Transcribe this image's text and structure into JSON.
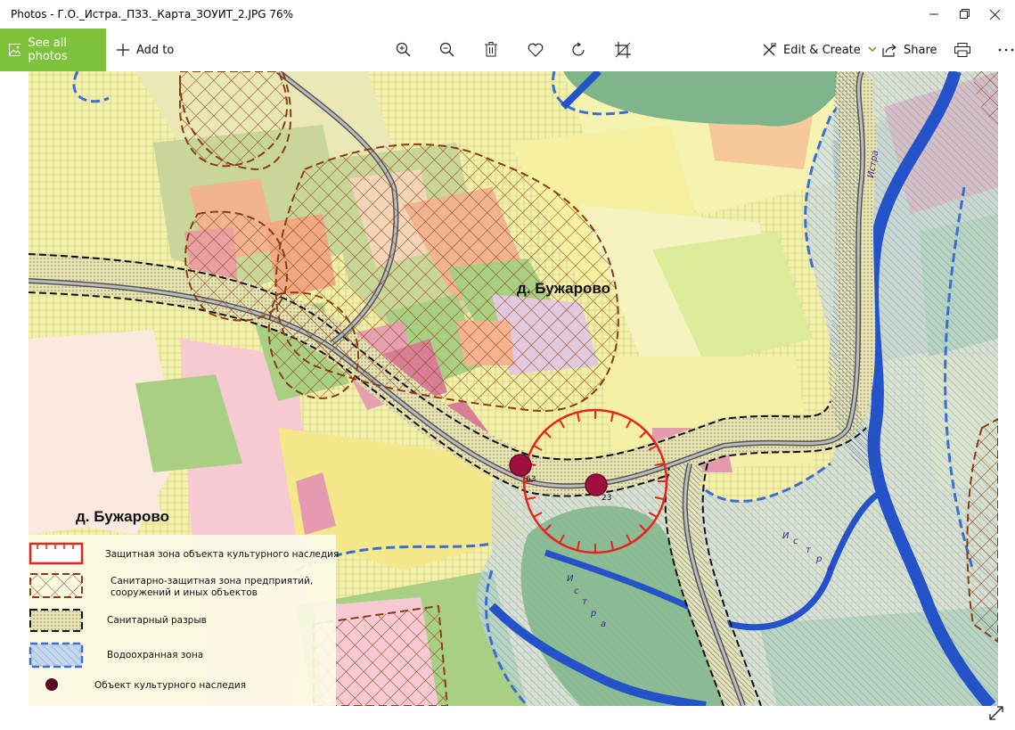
{
  "window": {
    "title": "Photos - Г.О._Истра._ПЗЗ._Карта_ЗОУИТ_2.JPG   76%",
    "minimize_icon": "minimize-icon",
    "maximize_icon": "restore-icon",
    "close_icon": "close-icon"
  },
  "toolbar": {
    "see_all_label": "See all photos",
    "add_to_label": "Add to",
    "edit_create_label": "Edit & Create",
    "share_label": "Share",
    "icons": [
      "zoom-in-icon",
      "zoom-out-icon",
      "delete-icon",
      "favorite-icon",
      "rotate-icon",
      "crop-icon",
      "print-icon",
      "more-icon"
    ],
    "accent": "#7ec23b"
  },
  "map": {
    "place_label_main": "д. Бужарово",
    "place_label_secondary": "д. Бужарово",
    "river_label": "Истра",
    "river_label_letters": [
      "И",
      "с",
      "т",
      "р",
      "а"
    ],
    "monument_numbers": [
      "63",
      "23"
    ],
    "legend": [
      {
        "label": "Защитная зона объекта культурного наследия",
        "color": "#e8221c"
      },
      {
        "label_line1": "Санитарно-защитная зона предприятий,",
        "label_line2": "сооружений и иных объектов",
        "color": "#9a3a12"
      },
      {
        "label": "Санитарный разрыв",
        "color": "#111111"
      },
      {
        "label": "Водоохранная зона",
        "color": "#3a6ed0"
      },
      {
        "label": "Объект культурного наследия",
        "color": "#5a0a24"
      }
    ]
  }
}
